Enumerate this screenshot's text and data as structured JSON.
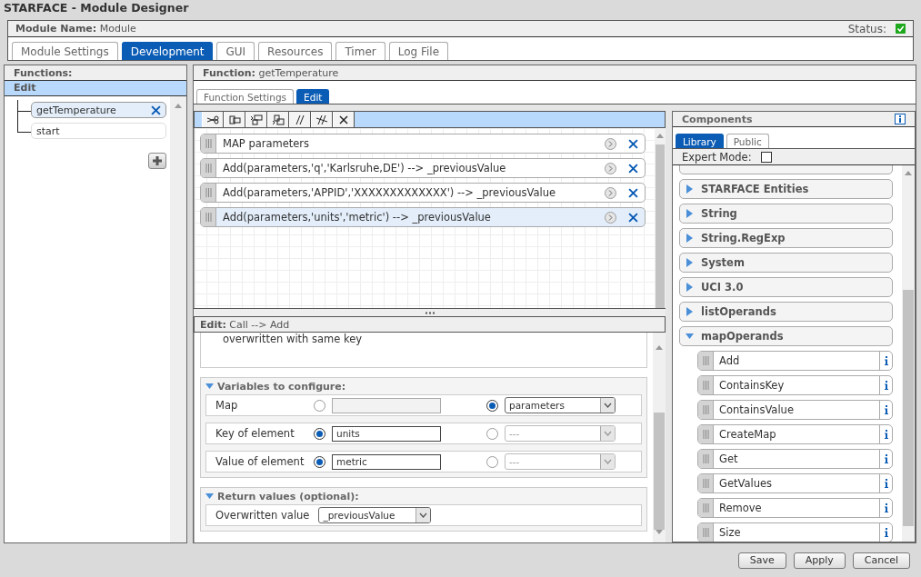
{
  "window": {
    "title": "STARFACE - Module Designer"
  },
  "module": {
    "name_label": "Module Name:",
    "name": "Module",
    "status_label": "Status:",
    "status_ok": true
  },
  "tabs": [
    {
      "label": "Module Settings",
      "selected": false
    },
    {
      "label": "Development",
      "selected": true
    },
    {
      "label": "GUI",
      "selected": false
    },
    {
      "label": "Resources",
      "selected": false
    },
    {
      "label": "Timer",
      "selected": false
    },
    {
      "label": "Log File",
      "selected": false
    }
  ],
  "functions": {
    "title": "Functions:",
    "group": "Edit",
    "items": [
      {
        "label": "getTemperature",
        "selected": true
      },
      {
        "label": "start",
        "selected": false
      }
    ]
  },
  "function_panel": {
    "label": "Function:",
    "name": "getTemperature",
    "tabs": [
      {
        "label": "Function Settings",
        "selected": false
      },
      {
        "label": "Edit",
        "selected": true
      }
    ]
  },
  "statements": [
    {
      "text": "MAP parameters",
      "selected": false
    },
    {
      "text": "Add(parameters,'q','Karlsruhe,DE') --> _previousValue",
      "selected": false
    },
    {
      "text": "Add(parameters,'APPID','XXXXXXXXXXXXX') --> _previousValue",
      "selected": false
    },
    {
      "text": "Add(parameters,'units','metric') --> _previousValue",
      "selected": true
    }
  ],
  "edit": {
    "label": "Edit:",
    "path": "Call --> Add",
    "description": "overwritten with same key",
    "variables_title": "Variables to configure:",
    "variables": [
      {
        "label": "Map",
        "options": [
          {
            "kind": "text",
            "selected": false
          },
          {
            "kind": "select",
            "selected": true,
            "value": "parameters"
          }
        ]
      },
      {
        "label": "Key of element",
        "options": [
          {
            "kind": "text",
            "selected": true,
            "value": "units"
          },
          {
            "kind": "select",
            "selected": false,
            "value": "---"
          }
        ]
      },
      {
        "label": "Value of element",
        "options": [
          {
            "kind": "text",
            "selected": true,
            "value": "metric"
          },
          {
            "kind": "select",
            "selected": false,
            "value": "---"
          }
        ]
      }
    ],
    "return_title": "Return values (optional):",
    "returns": [
      {
        "label": "Overwritten value",
        "value": "_previousValue"
      }
    ]
  },
  "components": {
    "title": "Components",
    "tabs": [
      {
        "label": "Library",
        "selected": true
      },
      {
        "label": "Public",
        "selected": false
      }
    ],
    "expert_mode_label": "Expert Mode:",
    "expert_mode": false,
    "categories": [
      {
        "label": "STARFACE Entities",
        "expanded": false
      },
      {
        "label": "String",
        "expanded": false
      },
      {
        "label": "String.RegExp",
        "expanded": false
      },
      {
        "label": "System",
        "expanded": false
      },
      {
        "label": "UCI 3.0",
        "expanded": false
      },
      {
        "label": "listOperands",
        "expanded": false
      },
      {
        "label": "mapOperands",
        "expanded": true,
        "children": [
          {
            "label": "Add"
          },
          {
            "label": "ContainsKey"
          },
          {
            "label": "ContainsValue"
          },
          {
            "label": "CreateMap"
          },
          {
            "label": "Get"
          },
          {
            "label": "GetValues"
          },
          {
            "label": "Remove"
          },
          {
            "label": "Size"
          }
        ]
      }
    ]
  },
  "buttons": [
    "Save",
    "Apply",
    "Cancel"
  ]
}
